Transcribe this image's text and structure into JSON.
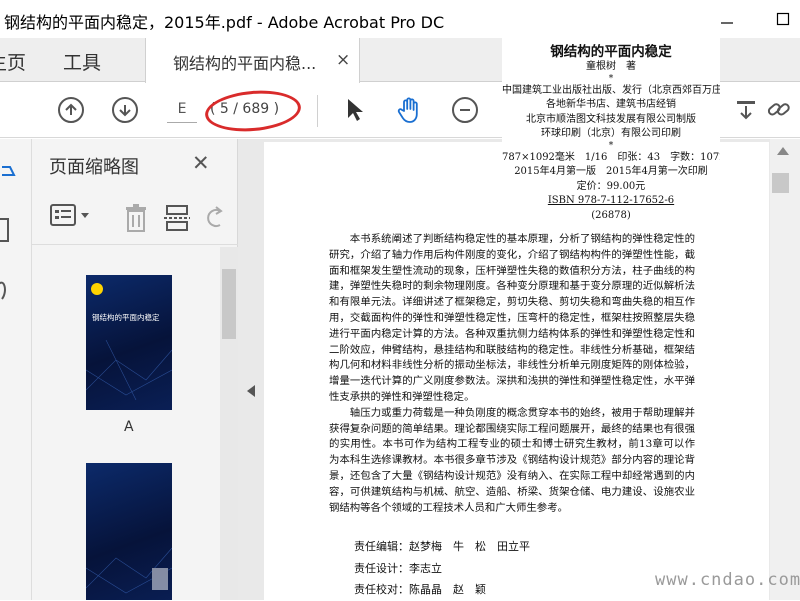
{
  "window": {
    "title": "钢结构的平面内稳定，2015年.pdf - Adobe Acrobat Pro DC"
  },
  "tabs": {
    "home": "主页",
    "tools": "工具",
    "document": "钢结构的平面内稳...",
    "close": "×",
    "help": "?"
  },
  "toolbar": {
    "page_input": "E",
    "page_count": "( 5 / 689 )"
  },
  "panel": {
    "title": "页面缩略图",
    "close": "✕",
    "thumbnail_label": "A",
    "cover_title": "钢结构的平面内稳定"
  },
  "copyright": {
    "title": "钢结构的平面内稳定",
    "author": "童根树　著",
    "star": "*",
    "lines": [
      "中国建筑工业出版社出版、发行（北京西郊百万庄）",
      "各地新华书店、建筑书店经销",
      "北京市顺浩图文科技发展有限公司制版",
      "环球印刷（北京）有限公司印刷",
      "*",
      "787×1092毫米　1/16　印张：43　字数：1072千字",
      "2015年4月第一版　2015年4月第一次印刷",
      "定价：99.00元",
      "ISBN 978-7-112-17652-6",
      "(26878)"
    ]
  },
  "body": {
    "paragraphs": [
      "本书系统阐述了判断结构稳定性的基本原理，分析了钢结构的弹性稳定性的研究，介绍了轴力作用后构件刚度的变化，介绍了钢结构构件的弹塑性性能，截面和框架发生塑性流动的现象，压杆弹塑性失稳的数值积分方法，柱子曲线的构建，弹塑性失稳时的剩余物理刚度。各种变分原理和基于变分原理的近似解析法和有限单元法。详细讲述了框架稳定，剪切失稳、剪切失稳和弯曲失稳的相互作用，交截面构件的弹性和弹塑性稳定性，压弯杆的稳定性，框架柱按照整层失稳进行平面内稳定计算的方法。各种双重抗侧力结构体系的弹性和弹塑性稳定性和二阶效应，伸臂结构，悬挂结构和联肢结构的稳定性。非线性分析基础，框架结构几何和材料非线性分析的振动坐标法，非线性分析单元刚度矩阵的刚体检验，增量一迭代计算的广义刚度参数法。深拱和浅拱的弹性和弹塑性稳定性，水平弹性支承拱的弹性和弹塑性稳定。",
      "轴压力或重力荷载是一种负刚度的概念贯穿本书的始终，被用于帮助理解并获得复杂问题的简单结果。理论都围绕实际工程问题展开，最终的结果也有很强的实用性。本书可作为结构工程专业的硕士和博士研究生教材，前13章可以作为本科生选修课教材。本书很多章节涉及《钢结构设计规范》部分内容的理论背景，还包含了大量《钢结构设计规范》没有纳入、在实际工程中却经常遇到的内容，可供建筑结构与机械、航空、造船、桥梁、货架仓储、电力建设、设施农业钢结构等各个领域的工程技术人员和广大师生参考。"
    ],
    "credits": [
      "责任编辑：赵梦梅　牛　松　田立平",
      "责任设计：李志立",
      "责任校对：陈晶晶　赵　颖"
    ]
  },
  "watermark": "www.cndao.com"
}
